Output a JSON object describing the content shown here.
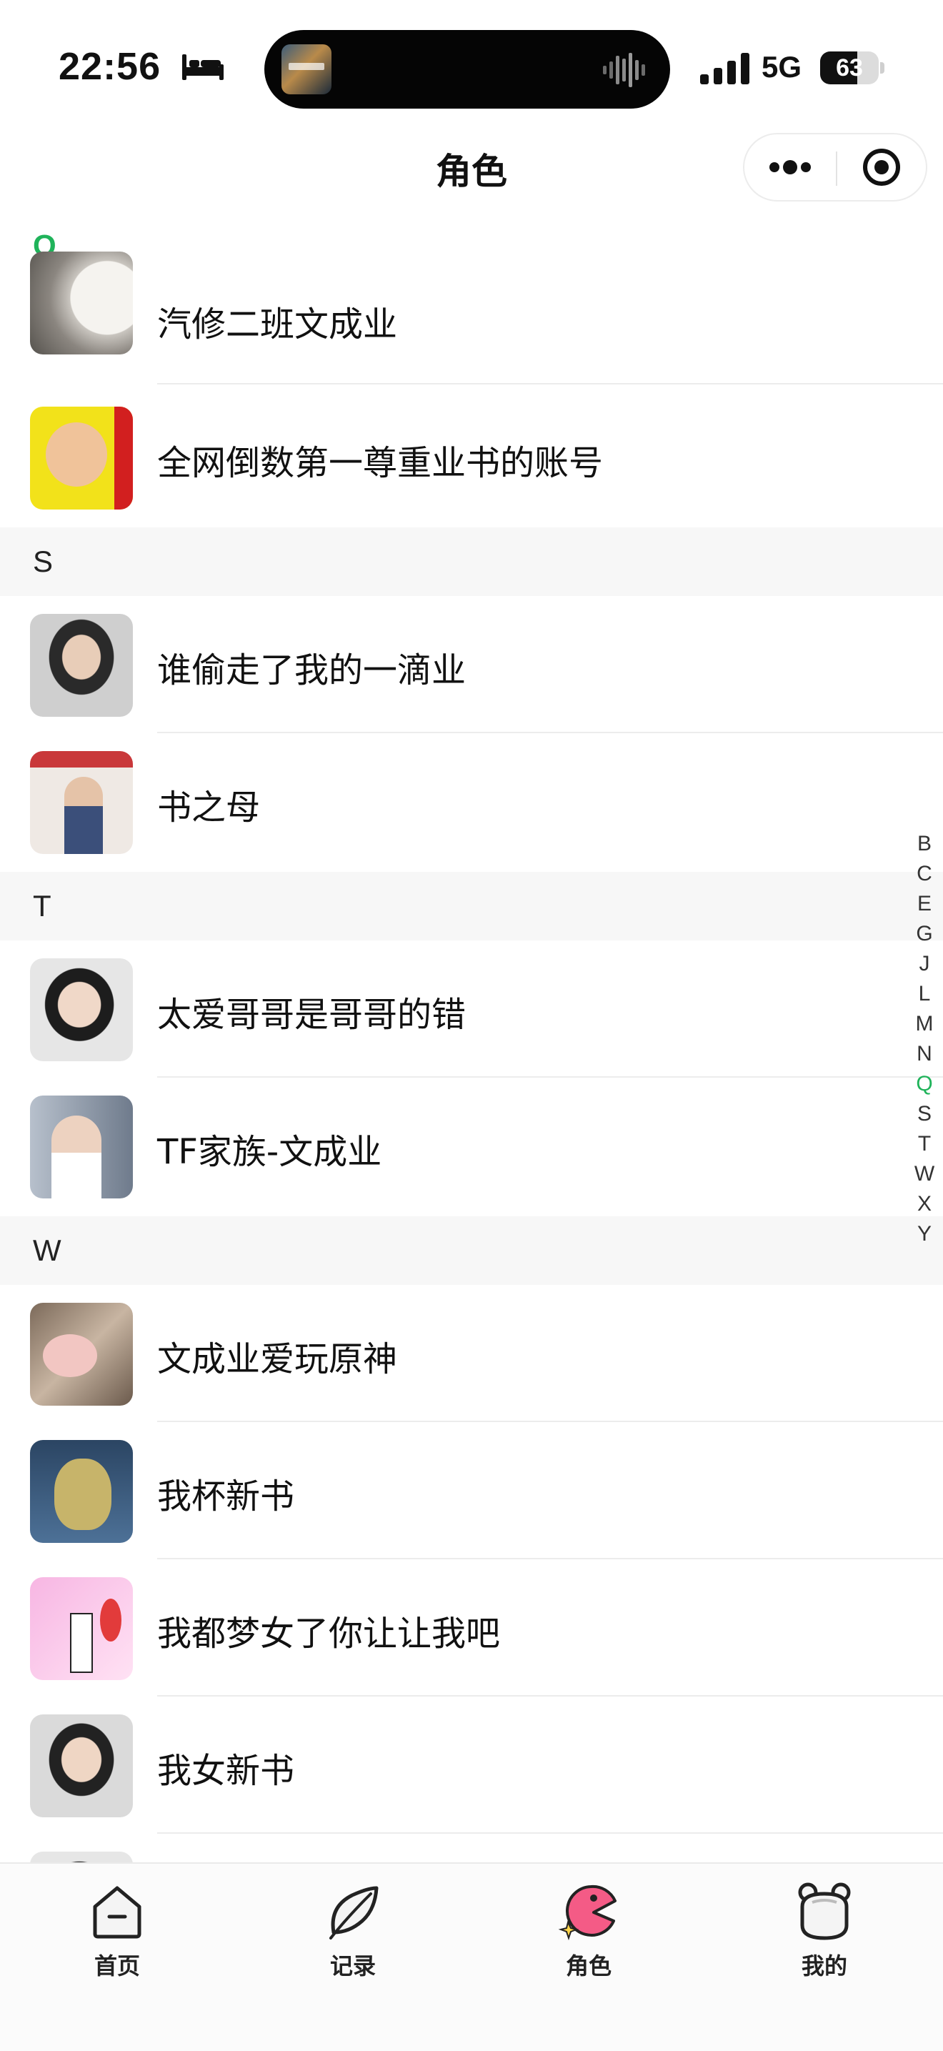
{
  "status_bar": {
    "time": "22:56",
    "network": "5G",
    "battery_percent": "63",
    "battery_level": 0.63
  },
  "nav": {
    "title": "角色"
  },
  "sections": [
    {
      "letter": "Q",
      "items": [
        {
          "name": "汽修二班文成业",
          "avatar": "dog-photo"
        },
        {
          "name": "全网倒数第一尊重业书的账号",
          "avatar": "baby-photo"
        }
      ]
    },
    {
      "letter": "S",
      "items": [
        {
          "name": "谁偷走了我的一滴业",
          "avatar": "portrait-photo"
        },
        {
          "name": "书之母",
          "avatar": "portrait-photo"
        }
      ]
    },
    {
      "letter": "T",
      "items": [
        {
          "name": "太爱哥哥是哥哥的错",
          "avatar": "portrait-photo"
        },
        {
          "name": "TF家族-文成业",
          "avatar": "portrait-photo"
        }
      ]
    },
    {
      "letter": "W",
      "items": [
        {
          "name": "文成业爱玩原神",
          "avatar": "piglet-photo"
        },
        {
          "name": "我杯新书",
          "avatar": "toy-photo"
        },
        {
          "name": "我都梦女了你让让我吧",
          "avatar": "comic-image"
        },
        {
          "name": "我女新书",
          "avatar": "portrait-photo"
        }
      ]
    }
  ],
  "index_letters": [
    "B",
    "C",
    "E",
    "G",
    "J",
    "L",
    "M",
    "N",
    "Q",
    "S",
    "T",
    "W",
    "X",
    "Y"
  ],
  "active_index": "Q",
  "tabs": [
    {
      "label": "首页",
      "icon": "home-icon"
    },
    {
      "label": "记录",
      "icon": "feather-icon"
    },
    {
      "label": "角色",
      "icon": "character-icon",
      "active": true
    },
    {
      "label": "我的",
      "icon": "bear-icon"
    }
  ],
  "colors": {
    "accent": "#1fb35a",
    "section_bg": "#f7f7f7",
    "divider": "#ececec"
  }
}
